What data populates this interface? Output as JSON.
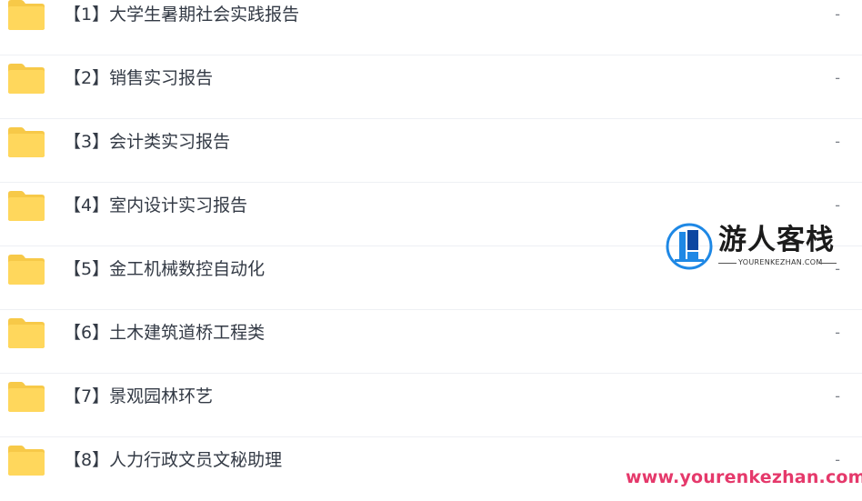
{
  "file_list": {
    "folder_icon": "folder-icon",
    "folder_color": "#FFD75C",
    "rows": [
      {
        "name": "【1】大学生暑期社会实践报告",
        "size": "-"
      },
      {
        "name": "【2】销售实习报告",
        "size": "-"
      },
      {
        "name": "【3】会计类实习报告",
        "size": "-"
      },
      {
        "name": "【4】室内设计实习报告",
        "size": "-"
      },
      {
        "name": "【5】金工机械数控自动化",
        "size": "-"
      },
      {
        "name": "【6】土木建筑道桥工程类",
        "size": "-"
      },
      {
        "name": "【7】景观园林环艺",
        "size": "-"
      },
      {
        "name": "【8】人力行政文员文秘助理",
        "size": "-"
      }
    ]
  },
  "watermark": {
    "logo_title": "游人客栈",
    "logo_subtitle": "YOURENKEZHAN.COM",
    "url": "www.yourenkezhan.com",
    "logo_blue": "#1E88E5",
    "url_color": "#E5396B"
  }
}
